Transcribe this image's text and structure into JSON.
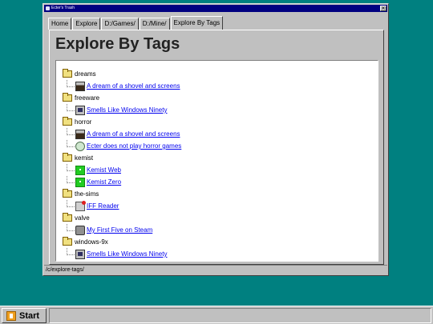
{
  "window": {
    "title": "Ecter's Trash",
    "close_label": "✕"
  },
  "tabs": [
    "Home",
    "Explore",
    "D:/Games/",
    "D:/Mine/",
    "Explore By Tags"
  ],
  "page": {
    "heading": "Explore By Tags"
  },
  "tree": [
    {
      "tag": "dreams",
      "items": [
        {
          "label": "A dream of a shovel and screens",
          "icon": "shovel-icon"
        }
      ]
    },
    {
      "tag": "freeware",
      "items": [
        {
          "label": "Smells Like Windows Ninety",
          "icon": "computer-icon"
        }
      ]
    },
    {
      "tag": "horror",
      "items": [
        {
          "label": "A dream of a shovel and screens",
          "icon": "shovel-icon"
        },
        {
          "label": "Ecter does not play horror games",
          "icon": "horror-icon"
        }
      ]
    },
    {
      "tag": "kemist",
      "items": [
        {
          "label": "Kemist Web",
          "icon": "kemist-icon"
        },
        {
          "label": "Kemist Zero",
          "icon": "kemist-icon"
        }
      ]
    },
    {
      "tag": "the-sims",
      "items": [
        {
          "label": "IFF Reader",
          "icon": "iff-icon"
        }
      ]
    },
    {
      "tag": "valve",
      "items": [
        {
          "label": "My First Five on Steam",
          "icon": "steam-icon"
        }
      ]
    },
    {
      "tag": "windows-9x",
      "items": [
        {
          "label": "Smells Like Windows Ninety",
          "icon": "computer-icon"
        }
      ]
    }
  ],
  "status": {
    "path": "/c/explore-tags/"
  },
  "taskbar": {
    "start_label": "Start"
  },
  "colors": {
    "desktop": "#008080",
    "titlebar": "#000080",
    "link": "#0000ee"
  }
}
